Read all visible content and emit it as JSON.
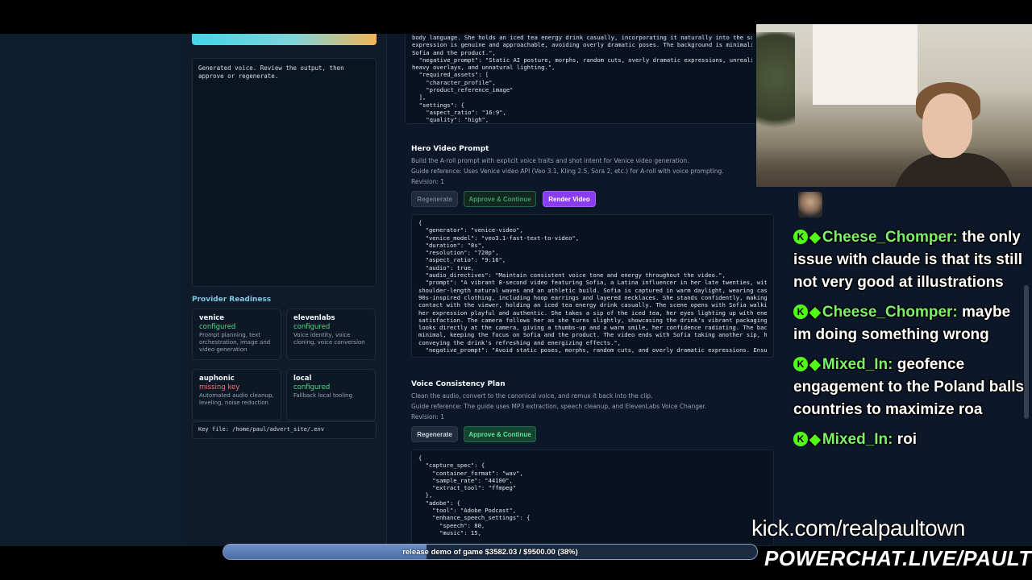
{
  "left_panel": {
    "voice_output_text": "Generated voice. Review the output, then approve or regenerate.",
    "readiness_title": "Provider Readiness",
    "providers": [
      {
        "name": "venice",
        "status": "configured",
        "status_kind": "ok",
        "desc": "Prompt planning, text orchestration, image and video generation"
      },
      {
        "name": "elevenlabs",
        "status": "configured",
        "status_kind": "ok",
        "desc": "Voice identity, voice cloning, voice conversion"
      },
      {
        "name": "auphonic",
        "status": "missing key",
        "status_kind": "bad",
        "desc": "Automated audio cleanup, leveling, noise reduction"
      },
      {
        "name": "local",
        "status": "configured",
        "status_kind": "ok",
        "desc": "Fallback local tooling"
      }
    ],
    "key_file": "Key file: /home/paul/advert_site/.env"
  },
  "main": {
    "top_code": "body language. She holds an iced tea energy drink casually, incorporating it naturally into the sce\nexpression is genuine and approachable, avoiding overly dramatic poses. The background is minimalis\nSofia and the product.\",\n  \"negative_prompt\": \"Static AI posture, morphs, random cuts, overly dramatic expressions, unrealist\nheavy overlays, and unnatural lighting.\",\n  \"required_assets\": [\n    \"character_profile\",\n    \"product_reference_image\"\n  ],\n  \"settings\": {\n    \"aspect_ratio\": \"16:9\",\n    \"quality\": \"high\",",
    "hero": {
      "title": "Hero Video Prompt",
      "desc": "Build the A-roll prompt with explicit voice traits and shot intent for Venice video generation.",
      "guide": "Guide reference: Uses Venice video API (Veo 3.1, Kling 2.5, Sora 2, etc.) for A-roll with voice prompting.",
      "revision": "Revision: 1",
      "regenerate_label": "Regenerate",
      "approve_label": "Approve & Continue",
      "render_label": "Render Video",
      "code": "{\n  \"generator\": \"venice-video\",\n  \"venice_model\": \"veo3.1-fast-text-to-video\",\n  \"duration\": \"8s\",\n  \"resolution\": \"720p\",\n  \"aspect_ratio\": \"9:16\",\n  \"audio\": true,\n  \"audio_directives\": \"Maintain consistent voice tone and energy throughout the video.\",\n  \"prompt\": \"A vibrant 8-second video featuring Sofia, a Latina influencer in her late twenties, with dark\nshoulder-length natural waves and an athletic build. Sofia is captured in warm daylight, wearing casual, trendy\n90s-inspired clothing, including hoop earrings and layered necklaces. She stands confidently, making direct eye\ncontact with the viewer, holding an iced tea energy drink casually. The scene opens with Sofia walking into fr\nher expression playful and authentic. She takes a sip of the iced tea, her eyes lighting up with energy and\nsatisfaction. The camera follows her as she turns slightly, showcasing the drink's vibrant packaging. Sofia then\nlooks directly at the camera, giving a thumbs-up and a warm smile, her confidence radiating. The background is\nminimal, keeping the focus on Sofia and the product. The video ends with Sofia taking another sip, her express\nconveying the drink's refreshing and energizing effects.\",\n  \"negative_prompt\": \"Avoid static poses, morphs, random cuts, and overly dramatic expressions. Ensure no voice"
    },
    "voice": {
      "title": "Voice Consistency Plan",
      "desc": "Clean the audio, convert to the canonical voice, and remux it back into the clip.",
      "guide": "Guide reference: The guide uses MP3 extraction, speech cleanup, and ElevenLabs Voice Changer.",
      "revision": "Revision: 1",
      "regenerate_label": "Regenerate",
      "approve_label": "Approve & Continue",
      "code": "{\n  \"capture_spec\": {\n    \"container_format\": \"wav\",\n    \"sample_rate\": \"44100\",\n    \"extract_tool\": \"ffmpeg\"\n  },\n  \"adobe\": {\n    \"tool\": \"Adobe Podcast\",\n    \"enhance_speech_settings\": {\n      \"speech\": 80,\n      \"music\": 15,"
    }
  },
  "chat": {
    "messages": [
      {
        "user": "Cheese_Chomper:",
        "text": "the only issue with claude is that its still not very good at illustrations"
      },
      {
        "user": "Cheese_Chomper:",
        "text": "maybe im doing something wrong"
      },
      {
        "user": "Mixed_In:",
        "text": "geofence engagement to the Poland balls countries to maximize roa"
      },
      {
        "user": "Mixed_In:",
        "text": "roi"
      }
    ],
    "badge_glyph": "K",
    "diamond_glyph": "◆"
  },
  "overlay": {
    "kick_url": "kick.com/realpaultown",
    "powerchat": "POWERCHAT.LIVE/PAULTOWN",
    "goal_text": "release demo of game $3582.03 / $9500.00 (38%)",
    "goal_fraction": 0.38,
    "accent": "#53fc18"
  }
}
